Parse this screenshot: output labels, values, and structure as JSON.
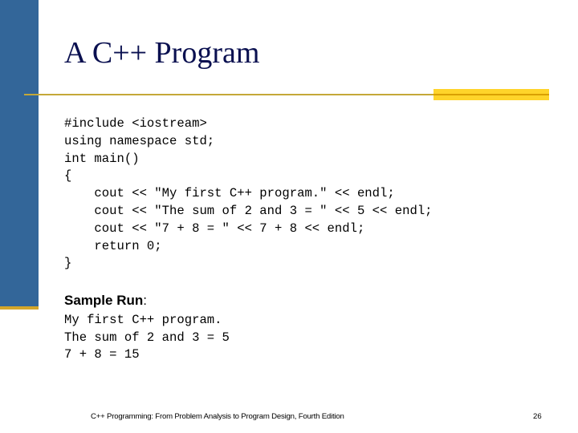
{
  "slide": {
    "title": "A C++ Program",
    "code_lines": [
      "#include <iostream>",
      "using namespace std;",
      "int main()",
      "{",
      "    cout << \"My first C++ program.\" << endl;",
      "    cout << \"The sum of 2 and 3 = \" << 5 << endl;",
      "    cout << \"7 + 8 = \" << 7 + 8 << endl;",
      "    return 0;",
      "}"
    ],
    "sample_run_label": "Sample Run",
    "sample_run_colon": ":",
    "output_lines": [
      "My first C++ program.",
      "The sum of 2 and 3 = 5",
      "7 + 8 = 15"
    ],
    "footer": "C++ Programming: From Problem Analysis to Program Design, Fourth Edition",
    "page_number": "26"
  },
  "colors": {
    "sidebar": "#336699",
    "accent_gold": "#d4a62a",
    "title_text": "#0a1050",
    "highlight_bar": "#ffd42a"
  }
}
